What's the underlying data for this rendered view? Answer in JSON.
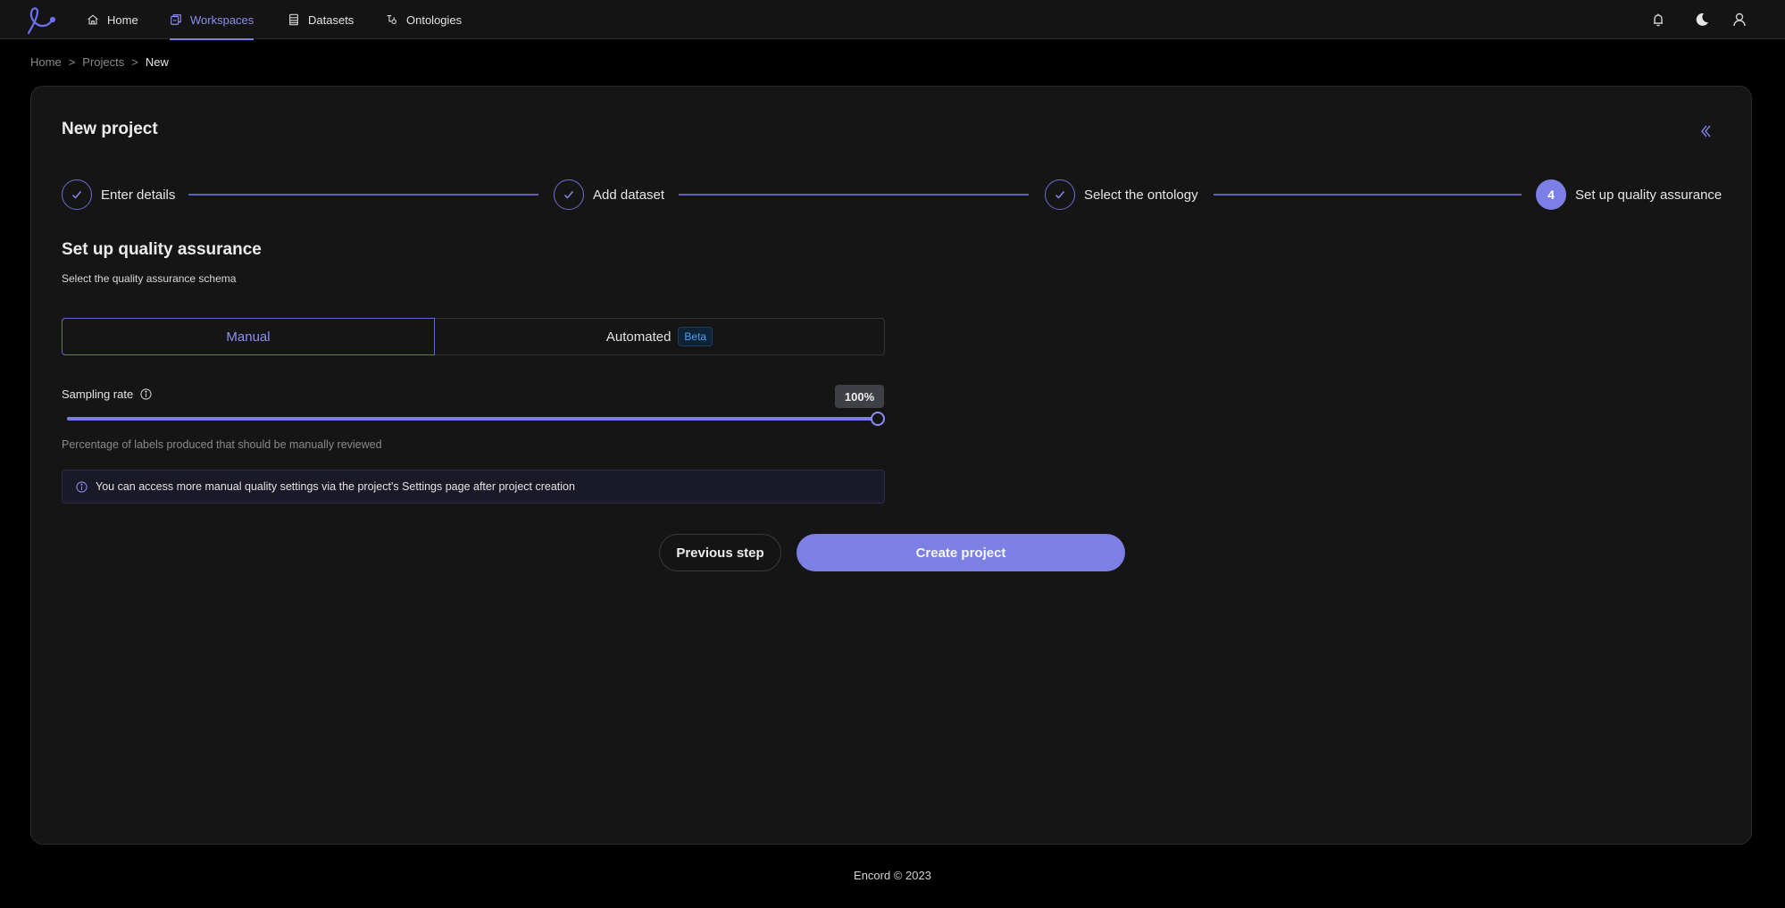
{
  "nav": {
    "items": [
      {
        "label": "Home",
        "icon": "home-icon"
      },
      {
        "label": "Workspaces",
        "icon": "workspaces-icon",
        "active": true
      },
      {
        "label": "Datasets",
        "icon": "datasets-icon"
      },
      {
        "label": "Ontologies",
        "icon": "ontologies-icon"
      }
    ],
    "right_icons": [
      "bell-icon",
      "moon-icon",
      "user-icon"
    ]
  },
  "breadcrumb": {
    "items": [
      "Home",
      "Projects",
      "New"
    ],
    "separator": ">"
  },
  "card": {
    "title": "New project",
    "steps": [
      {
        "label": "Enter details",
        "state": "complete"
      },
      {
        "label": "Add dataset",
        "state": "complete"
      },
      {
        "label": "Select the ontology",
        "state": "complete"
      },
      {
        "label": "Set up quality assurance",
        "state": "current",
        "number": "4"
      }
    ]
  },
  "qa": {
    "title": "Set up quality assurance",
    "subtitle": "Select the quality assurance schema",
    "options": [
      {
        "label": "Manual",
        "selected": true
      },
      {
        "label": "Automated",
        "badge": "Beta",
        "selected": false
      }
    ],
    "sampling": {
      "label": "Sampling rate",
      "value_text": "100%",
      "value": 100,
      "min": 0,
      "max": 100,
      "help": "Percentage of labels produced that should be manually reviewed"
    },
    "info": "You can access more manual quality settings via the project's Settings page after project creation"
  },
  "actions": {
    "previous": "Previous step",
    "create": "Create project"
  },
  "footer": "Encord © 2023",
  "colors": {
    "accent": "#7b7fe6",
    "background": "#000000",
    "card": "#151516"
  }
}
